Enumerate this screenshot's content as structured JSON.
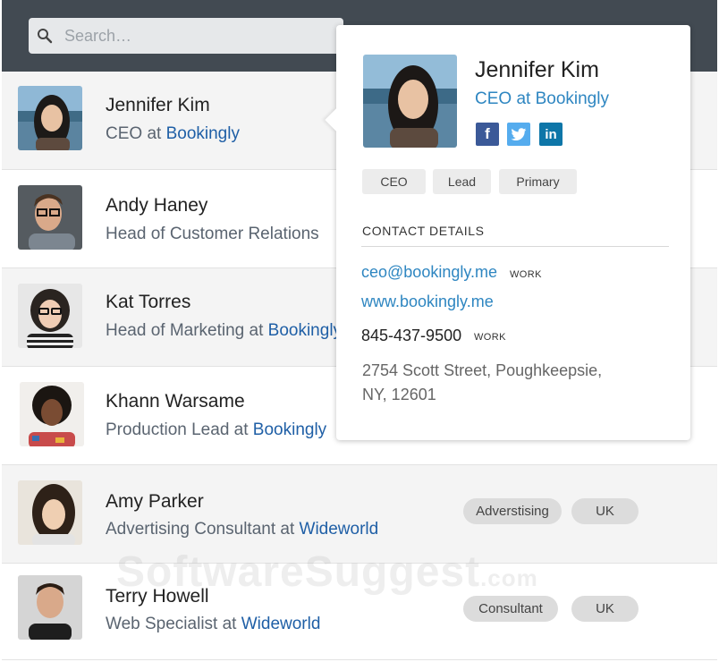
{
  "search": {
    "placeholder": "Search…"
  },
  "contacts": [
    {
      "name": "Jennifer Kim",
      "role_prefix": "CEO at ",
      "company": "Bookingly",
      "tags": []
    },
    {
      "name": "Andy Haney",
      "role_prefix": "Head of Customer Relations",
      "company": "",
      "tags": []
    },
    {
      "name": "Kat Torres",
      "role_prefix": "Head of Marketing at ",
      "company": "Bookingly",
      "tags": []
    },
    {
      "name": "Khann Warsame",
      "role_prefix": "Production Lead at ",
      "company": "Bookingly",
      "tags": []
    },
    {
      "name": "Amy Parker",
      "role_prefix": "Advertising Consultant at ",
      "company": "Wideworld",
      "tags": [
        "Adverstising",
        "UK"
      ]
    },
    {
      "name": "Terry Howell",
      "role_prefix": "Web Specialist at ",
      "company": "Wideworld",
      "tags": [
        "Consultant",
        "UK"
      ]
    }
  ],
  "popup": {
    "name": "Jennifer Kim",
    "title_prefix": "CEO at ",
    "company": "Bookingly",
    "social": [
      {
        "icon": "facebook-icon",
        "glyph": "f",
        "color": "#3b5998"
      },
      {
        "icon": "twitter-icon",
        "glyph": "t",
        "color": "#55acee"
      },
      {
        "icon": "linkedin-icon",
        "glyph": "in",
        "color": "#0e76a8"
      }
    ],
    "tags": [
      "CEO",
      "Lead",
      "Primary"
    ],
    "section_label": "CONTACT DETAILS",
    "email": "ceo@bookingly.me",
    "email_type": "WORK",
    "website": "www.bookingly.me",
    "phone": "845-437-9500",
    "phone_type": "WORK",
    "address_line1": "2754 Scott Street, Poughkeepsie,",
    "address_line2": "NY, 12601"
  },
  "colors": {
    "topbar": "#424a52",
    "link": "#2e86c1",
    "company": "#1f5fa6"
  },
  "watermark": {
    "text": "SoftwareSuggest",
    "suffix": ".com"
  }
}
